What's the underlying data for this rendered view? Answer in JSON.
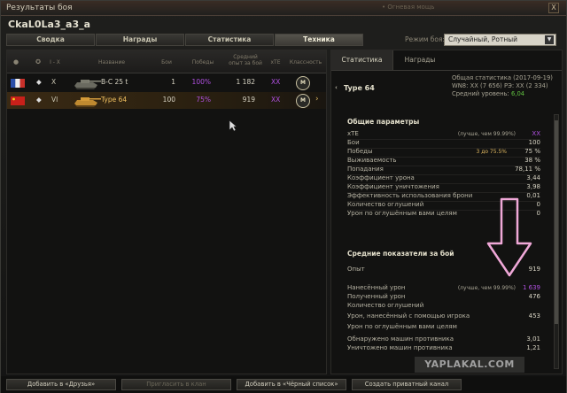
{
  "window": {
    "title": "Результаты боя",
    "titlebar_right": "• Огневая мощь",
    "close_label": "X"
  },
  "player_name": "CkaL0La3_a3_a",
  "tabs": [
    "Сводка",
    "Награды",
    "Статистика",
    "Техника"
  ],
  "active_tab": 3,
  "mode": {
    "label": "Режим боя:",
    "value": "Случайный, Ротный"
  },
  "table": {
    "headers": {
      "tier": "I - X",
      "name": "Название",
      "battles": "Бои",
      "wins": "Победы",
      "avg_dmg": "Средний\nопыт за бой",
      "xte": "xTE",
      "mastery": "Классность"
    },
    "rows": [
      {
        "nation": "france",
        "class_icon": "◆",
        "tier": "X",
        "name": "B-C 25 t",
        "battles": "1",
        "wins": "100%",
        "avg_dmg": "1 182",
        "xte": "XX",
        "mastery": "M",
        "selected": false
      },
      {
        "nation": "china",
        "class_icon": "◆",
        "tier": "VI",
        "name": "Type 64",
        "battles": "100",
        "wins": "75%",
        "avg_dmg": "919",
        "xte": "XX",
        "mastery": "M",
        "selected": true
      }
    ]
  },
  "right": {
    "tabs": [
      "Статистика",
      "Награды"
    ],
    "vehicle": "Type 64",
    "general": {
      "line1": "Общая статистика (2017-09-19)",
      "line2_prefix": "WN8: XX (7 656)  РЭ: XX (2 334)",
      "line3_label": "Средний уровень:",
      "line3_value": "6,04"
    },
    "sections": [
      {
        "title": "Общие параметры",
        "items": [
          {
            "label": "xTE",
            "note": "(лучше, чем 99.99%)",
            "value": "XX",
            "purple": true
          },
          {
            "label": "Бои",
            "value": "100"
          },
          {
            "label": "Победы",
            "note": "3 до 75.5%",
            "value": "75 %"
          },
          {
            "label": "Выживаемость",
            "value": "38 %"
          },
          {
            "label": "Попадания",
            "value": "78,11 %"
          },
          {
            "label": "Коэффициент урона",
            "value": "3,44"
          },
          {
            "label": "Коэффициент уничтожения",
            "value": "3,98"
          },
          {
            "label": "Эффективность использования брони",
            "value": "0,01"
          },
          {
            "label": "Количество оглушений",
            "value": "0"
          },
          {
            "label": "Урон по оглушённым вами целям",
            "value": "0"
          }
        ]
      },
      {
        "title": "Средние показатели за бой",
        "items": [
          {
            "label": "Опыт",
            "value": "919"
          },
          {
            "label": "Нанесённый урон",
            "note": "(лучше, чем 99.99%)",
            "value": "1 639",
            "purple": true
          },
          {
            "label": "Полученный урон",
            "value": "476"
          },
          {
            "label": "Количество оглушений",
            "value": ""
          },
          {
            "label": "Урон, нанесённый с помощью игрока",
            "value": "453"
          },
          {
            "label": "Урон по оглушённым вами целям",
            "value": ""
          },
          {
            "label": "Обнаружено машин противника",
            "value": "3,01"
          },
          {
            "label": "Уничтожено машин противника",
            "value": "1,21"
          }
        ]
      }
    ]
  },
  "bottom_buttons": [
    "Добавить в «Друзья»",
    "Пригласить в клан",
    "Добавить в «Чёрный список»",
    "Создать приватный канал"
  ],
  "watermark": "YAPLAKAL.COM",
  "colors": {
    "purple": "#b050e0",
    "accent": "#e0b860",
    "arrow": "#f0a8d8"
  }
}
